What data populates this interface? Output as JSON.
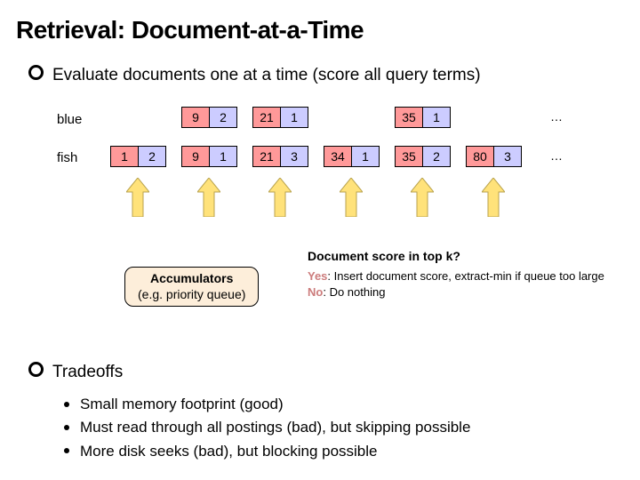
{
  "title": "Retrieval: Document-at-a-Time",
  "intro": "Evaluate documents one at a time (score all query terms)",
  "terms": {
    "blue": "blue",
    "fish": "fish"
  },
  "postings": {
    "blue_row": {
      "slot1": {
        "doc": "9",
        "cnt": "2"
      },
      "slot2": {
        "doc": "21",
        "cnt": "1"
      },
      "slot4": {
        "doc": "35",
        "cnt": "1"
      }
    },
    "fish_row": {
      "slot0": {
        "doc": "1",
        "cnt": "2"
      },
      "slot1": {
        "doc": "9",
        "cnt": "1"
      },
      "slot2": {
        "doc": "21",
        "cnt": "3"
      },
      "slot3": {
        "doc": "34",
        "cnt": "1"
      },
      "slot4": {
        "doc": "35",
        "cnt": "2"
      },
      "slot5": {
        "doc": "80",
        "cnt": "3"
      }
    },
    "ellipsis": "…"
  },
  "score_question": "Document score in top k?",
  "accumulators": {
    "title": "Accumulators",
    "sub": "(e.g. priority queue)"
  },
  "answers": {
    "yes_label": "Yes",
    "yes_text": ": Insert document score, extract-min if queue too large",
    "no_label": "No",
    "no_text": ": Do nothing"
  },
  "tradeoffs_heading": "Tradeoffs",
  "tradeoffs": {
    "a": "Small memory footprint (good)",
    "b": "Must read through all postings (bad), but skipping possible",
    "c": "More disk seeks (bad), but blocking possible"
  },
  "arrow_color": "#ffe27a",
  "arrow_stroke": "#b8a24d"
}
